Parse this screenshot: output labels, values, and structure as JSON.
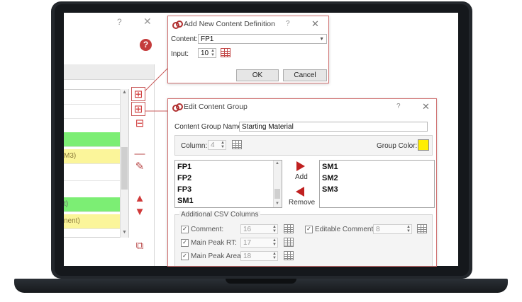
{
  "colors": {
    "accent": "#c02020",
    "row_green": "#7cee74",
    "row_yellow": "#fbf59a",
    "group_color": "#ffee00"
  },
  "background_window": {
    "title_help": "?",
    "title_close": "✕",
    "rows": [
      {
        "text": ""
      },
      {
        "text": ""
      },
      {
        "text": ""
      },
      {
        "text": ""
      },
      {
        "text": ""
      },
      {
        "text": ""
      },
      {
        "text": ""
      },
      {
        "text": ""
      },
      {
        "text": "t)"
      },
      {
        "text": "nent)"
      }
    ],
    "row_mid_yellow": "M3)"
  },
  "add_dialog": {
    "title": "Add New Content Definition",
    "help": "?",
    "close": "✕",
    "content_label": "Content:",
    "content_value": "FP1",
    "input_label": "Input:",
    "input_value": "10",
    "ok": "OK",
    "cancel": "Cancel"
  },
  "edit_dialog": {
    "title": "Edit Content Group",
    "help": "?",
    "close": "✕",
    "name_label": "Content Group Name:",
    "name_value": "Starting Material",
    "column_label": "Column:",
    "column_value": "4",
    "group_color_label": "Group Color:",
    "left_list": [
      "FP1",
      "FP2",
      "FP3",
      "SM1"
    ],
    "right_list": [
      "SM1",
      "SM2",
      "SM3"
    ],
    "add_label": "Add",
    "remove_label": "Remove",
    "csv_section_label": "Additional CSV Columns",
    "csv_rows": [
      {
        "label": "Comment:",
        "value": "16"
      },
      {
        "label": "Main Peak RT:",
        "value": "17"
      },
      {
        "label": "Main Peak Area:",
        "value": "18"
      }
    ],
    "editable_comment_label": "Editable Comment:",
    "editable_comment_value": "8"
  }
}
